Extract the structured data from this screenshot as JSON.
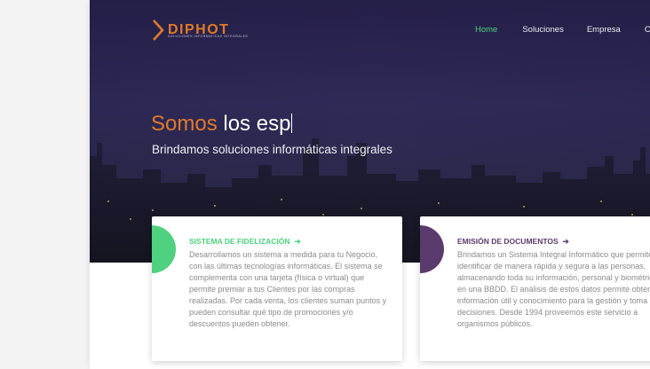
{
  "brand": {
    "name": "DIPHOT",
    "tagline": "SOLUCIONES INFORMATICAS INTEGRALES",
    "color": "#e07a2a"
  },
  "nav": {
    "items": [
      {
        "label": "Home",
        "active": true
      },
      {
        "label": "Soluciones",
        "active": false
      },
      {
        "label": "Empresa",
        "active": false
      },
      {
        "label": "Co",
        "active": false
      }
    ]
  },
  "hero": {
    "headline_accent": "Somos",
    "headline_rest": "los esp",
    "subtitle": "Brindamos soluciones informáticas integrales"
  },
  "cards": [
    {
      "title": "SISTEMA DE FIDELIZACIÓN",
      "arrow": "➔",
      "color": "#4fd17f",
      "body": "Desarrollamos un sistema a medida para tu Negocio, con las últimas tecnologías informáticas. El sistema se complementa con una tarjeta (física o virtual) que permite premiar a tus Clientes por las compras realizadas. Por cada venta, los clientes suman puntos y pueden consultar qué tipo de promociones y/o descuentos pueden obtener."
    },
    {
      "title": "EMISIÓN DE DOCUMENTOS",
      "arrow": "➔",
      "color": "#5b3a6e",
      "body": "Brindamos un Sistema Integral Informático que permite identificar de manera rápida y segura a las personas, almacenando toda su información, personal y biométrica, en una BBDD. El análisis de estos datos permite obtener información útil y conocimiento para la gestión y toma de decisiones. Desde 1994 proveemos este servicio a organismos públicos."
    }
  ]
}
